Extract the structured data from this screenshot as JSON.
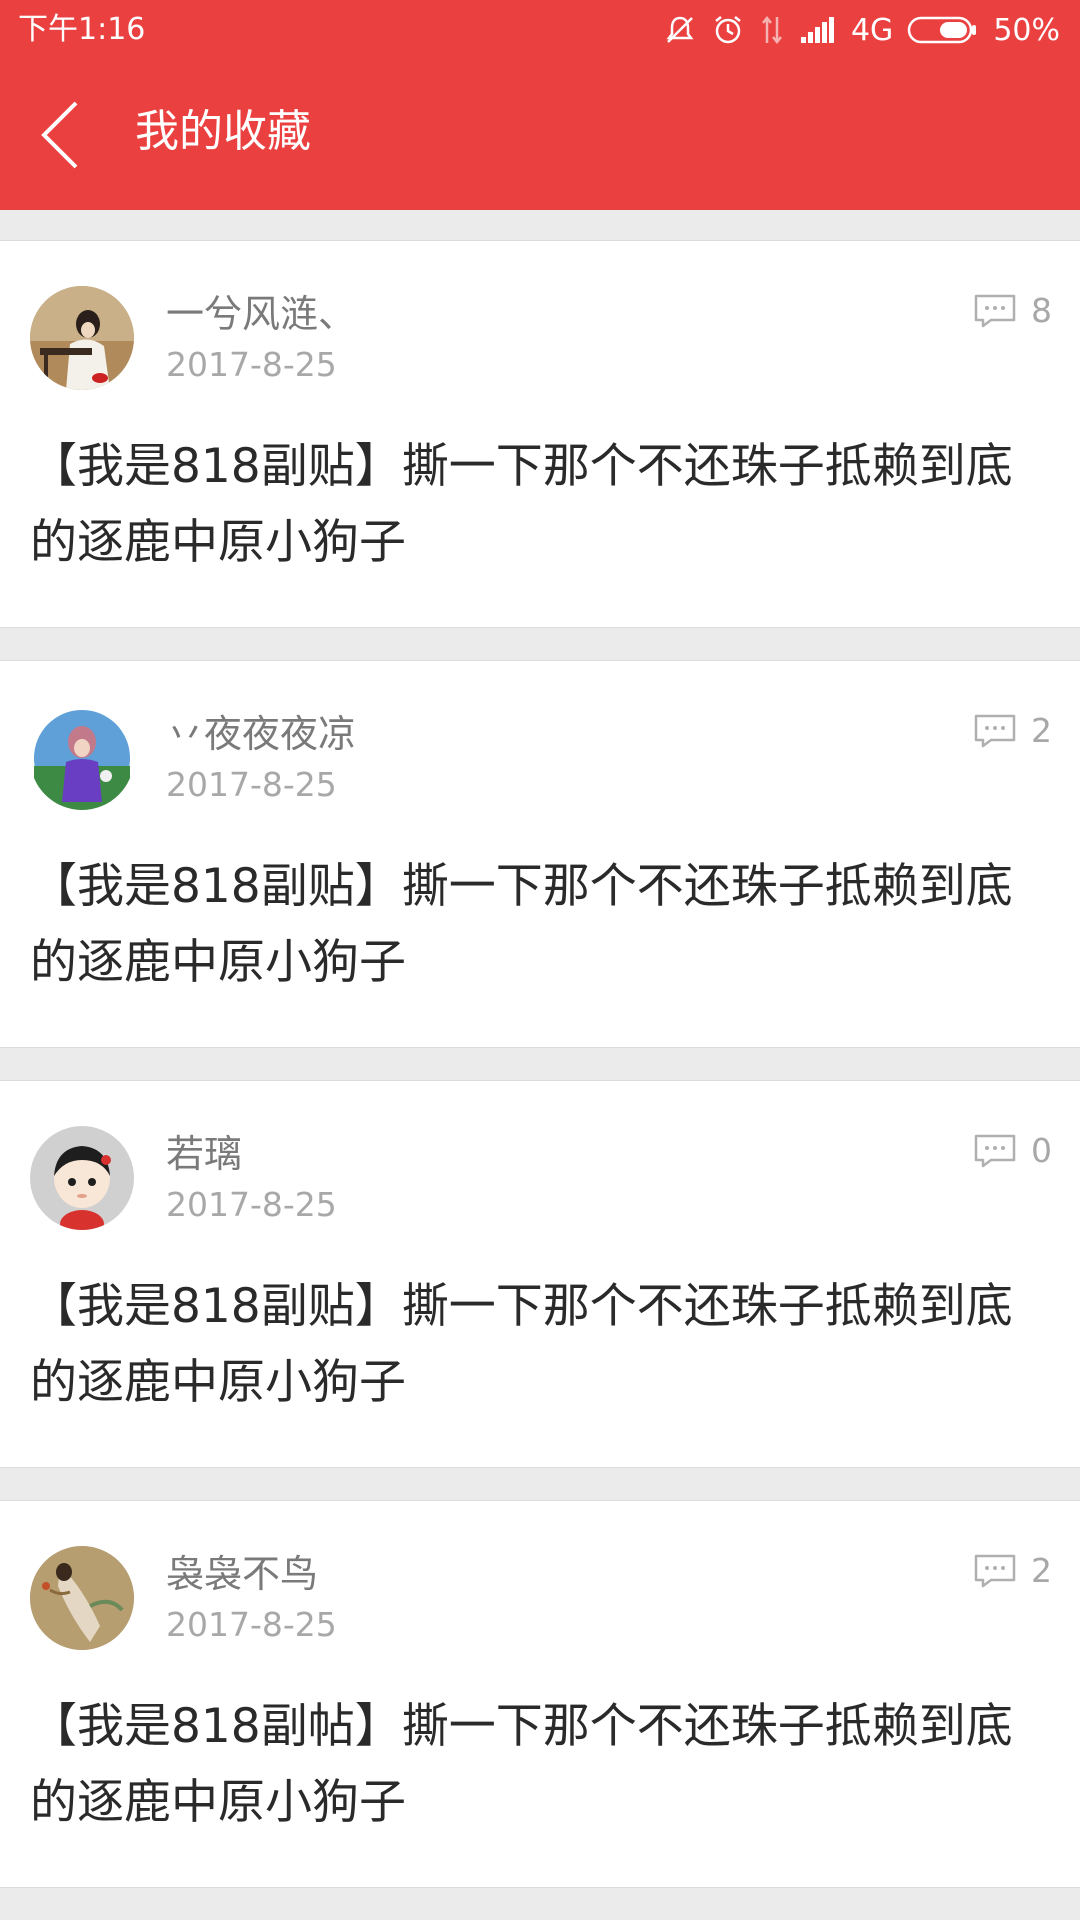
{
  "status_bar": {
    "time": "下午1:16",
    "network": "4G",
    "battery": "50%",
    "icons": [
      "mute-icon",
      "alarm-icon",
      "data-arrows-icon",
      "signal-icon",
      "battery-icon"
    ]
  },
  "header": {
    "title": "我的收藏",
    "back_icon": "back-chevron-icon",
    "background_color": "#eb4040"
  },
  "favorites": [
    {
      "username": "一兮风涟、",
      "date": "2017-8-25",
      "comments": "8",
      "title": "【我是818副贴】撕一下那个不还珠子抵赖到底的逐鹿中原小狗子",
      "avatar": "avatar-woman-guzheng"
    },
    {
      "username": "丷夜夜夜凉",
      "date": "2017-8-25",
      "comments": "2",
      "title": "【我是818副贴】撕一下那个不还珠子抵赖到底的逐鹿中原小狗子",
      "avatar": "avatar-game-character"
    },
    {
      "username": "若璃",
      "date": "2017-8-25",
      "comments": "0",
      "title": "【我是818副贴】撕一下那个不还珠子抵赖到底的逐鹿中原小狗子",
      "avatar": "avatar-default-cartoon"
    },
    {
      "username": "袅袅不鸟",
      "date": "2017-8-25",
      "comments": "2",
      "title": "【我是818副帖】撕一下那个不还珠子抵赖到底的逐鹿中原小狗子",
      "avatar": "avatar-painting-figure"
    }
  ]
}
